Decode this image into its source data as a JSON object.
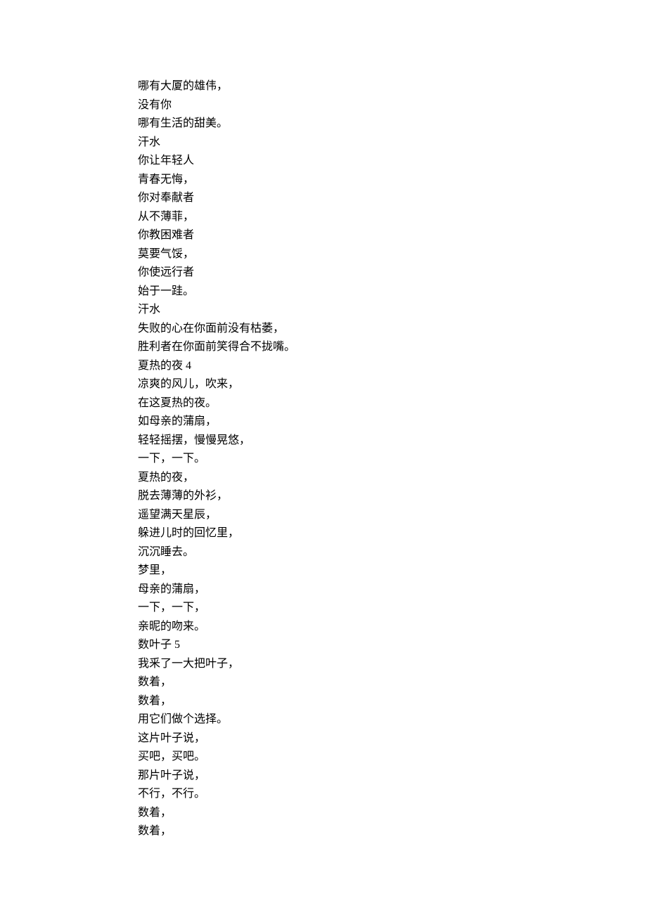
{
  "lines": [
    "哪有大厦的雄伟，",
    "没有你",
    "哪有生活的甜美。",
    "汗水",
    "你让年轻人",
    "青春无悔，",
    "你对奉献者",
    "从不薄菲，",
    "你教困难者",
    "莫要气馁，",
    "你使远行者",
    "始于一跬。",
    "汗水",
    "失败的心在你面前没有枯萎，",
    "胜利者在你面前笑得合不拢嘴。",
    "夏热的夜 4",
    "凉爽的风儿，吹来，",
    "在这夏热的夜。",
    "如母亲的蒲扇，",
    "轻轻摇摆，慢慢晃悠，",
    "一下，一下。",
    "夏热的夜，",
    "脱去薄薄的外衫，",
    "遥望满天星辰，",
    "躲进儿时的回忆里，",
    "沉沉睡去。",
    "梦里，",
    "母亲的蒲扇，",
    "一下，一下，",
    "亲昵的吻来。",
    "数叶子 5",
    "我釆了一大把叶子，",
    "数着，",
    "数着，",
    "用它们做个选择。",
    "这片叶子说，",
    "买吧，买吧。",
    "那片叶子说，",
    "不行，不行。",
    "数着，",
    "数着，"
  ]
}
